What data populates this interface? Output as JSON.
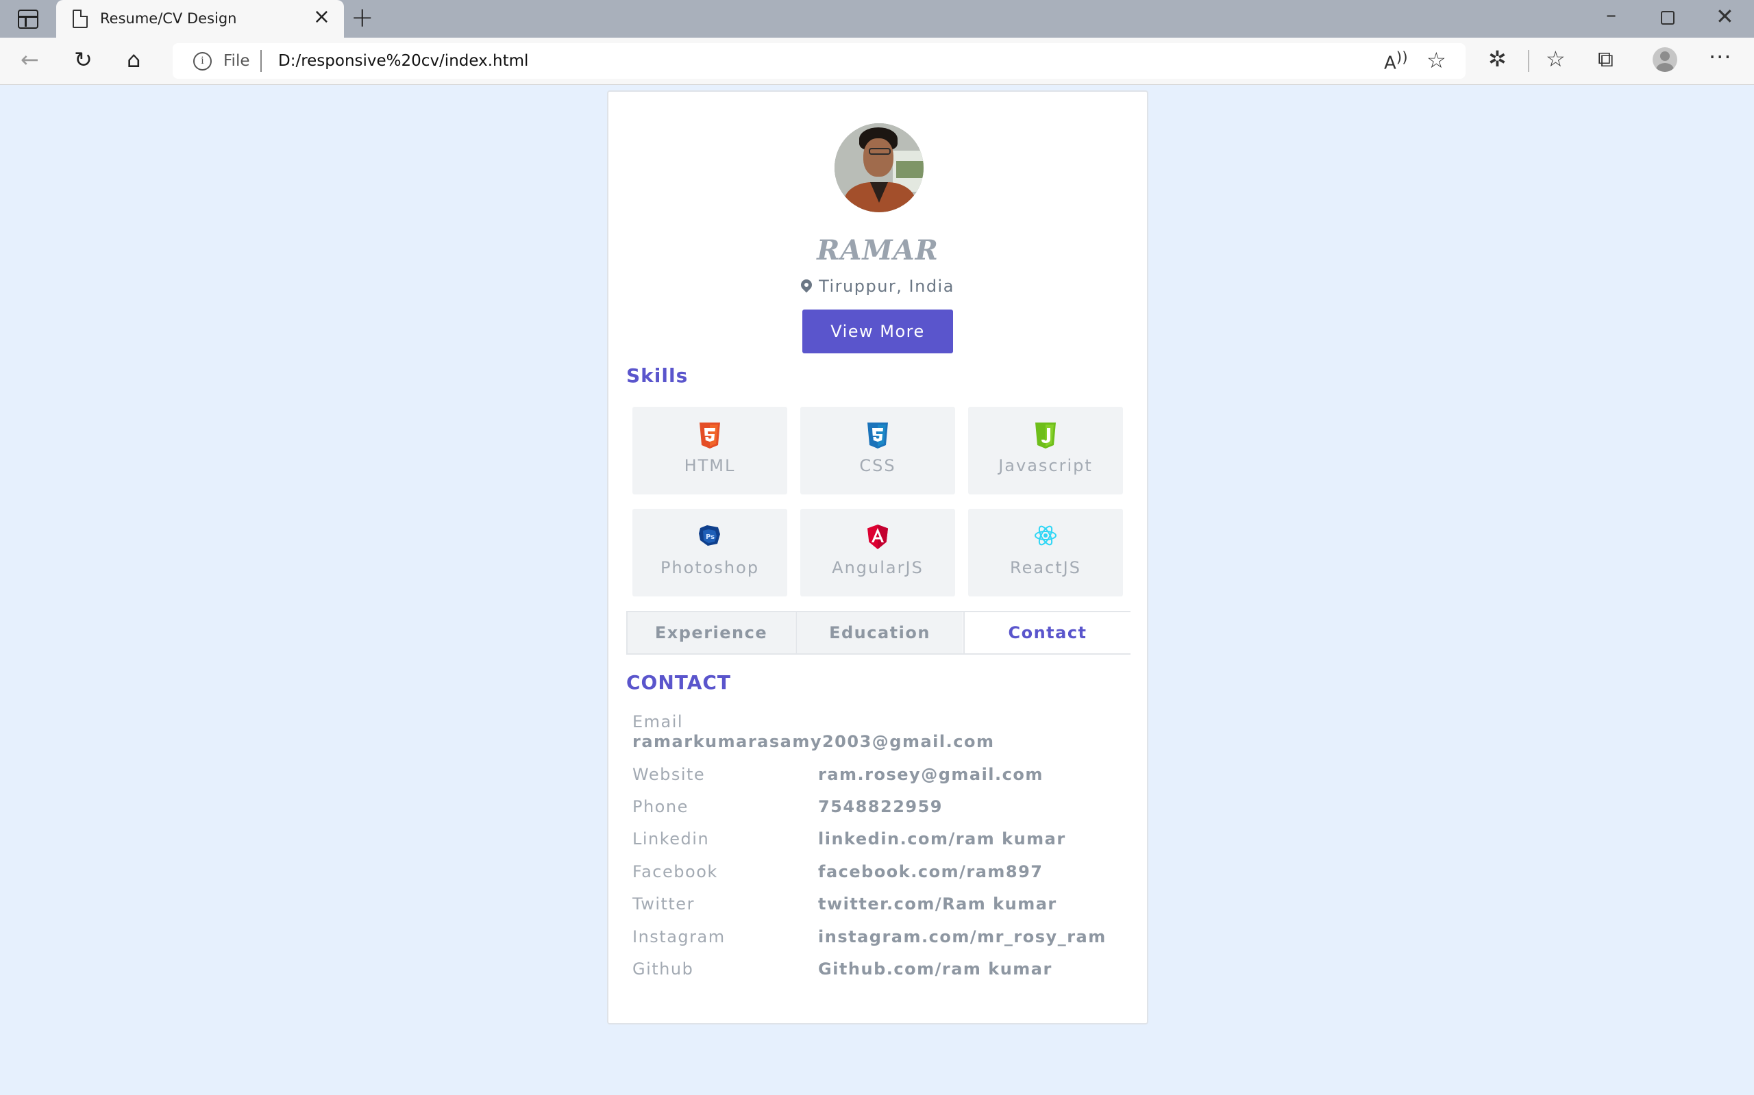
{
  "browser": {
    "tab_title": "Resume/CV Design",
    "address_scheme": "File",
    "address_url": "D:/responsive%20cv/index.html"
  },
  "profile": {
    "name": "RAMAR",
    "location": "Tiruppur, India",
    "view_more_label": "View More"
  },
  "skills": {
    "title": "Skills",
    "items": [
      {
        "label": "HTML",
        "icon": "html5-icon",
        "color": "#e44d26"
      },
      {
        "label": "CSS",
        "icon": "css3-icon",
        "color": "#1b73ba"
      },
      {
        "label": "Javascript",
        "icon": "javascript-icon",
        "color": "#6ebe1a"
      },
      {
        "label": "Photoshop",
        "icon": "photoshop-icon",
        "color": "#0f3f8c"
      },
      {
        "label": "AngularJS",
        "icon": "angular-icon",
        "color": "#dd0031"
      },
      {
        "label": "ReactJS",
        "icon": "react-icon",
        "color": "#2fd6f5"
      }
    ]
  },
  "tabs": [
    {
      "label": "Experience"
    },
    {
      "label": "Education"
    },
    {
      "label": "Contact",
      "active": true
    }
  ],
  "contact": {
    "title": "CONTACT",
    "email_label": "Email",
    "email_value": "ramarkumarasamy2003@gmail.com",
    "rows": [
      {
        "label": "Website",
        "value": "ram.rosey@gmail.com"
      },
      {
        "label": "Phone",
        "value": "7548822959"
      },
      {
        "label": "Linkedin",
        "value": "linkedin.com/ram kumar"
      },
      {
        "label": "Facebook",
        "value": "facebook.com/ram897"
      },
      {
        "label": "Twitter",
        "value": "twitter.com/Ram kumar"
      },
      {
        "label": "Instagram",
        "value": "instagram.com/mr_rosy_ram"
      },
      {
        "label": "Github",
        "value": "Github.com/ram kumar"
      }
    ]
  },
  "colors": {
    "accent": "#5a55cc",
    "page_bg": "#e6f0fd"
  }
}
